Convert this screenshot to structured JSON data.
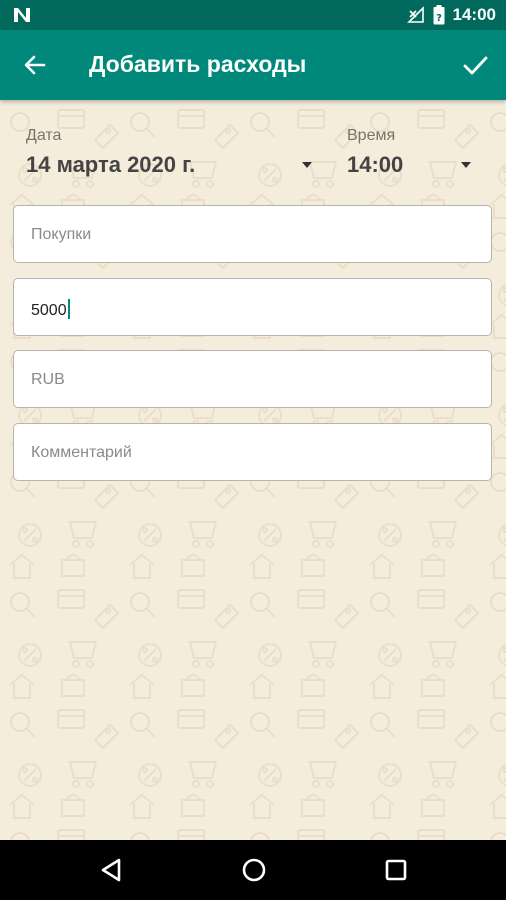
{
  "status_bar": {
    "time": "14:00",
    "icons": [
      "notification-n-icon",
      "signal-no-service-icon",
      "battery-icon"
    ]
  },
  "app_bar": {
    "title": "Добавить расходы",
    "back_icon": "arrow-left-icon",
    "confirm_icon": "check-icon"
  },
  "form": {
    "date": {
      "label": "Дата",
      "value": "14 марта 2020 г."
    },
    "time": {
      "label": "Время",
      "value": "14:00"
    },
    "fields": [
      {
        "placeholder": "Покупки",
        "value": ""
      },
      {
        "placeholder": "",
        "value": "5000"
      },
      {
        "placeholder": "RUB",
        "value": ""
      },
      {
        "placeholder": "Комментарий",
        "value": ""
      }
    ]
  },
  "nav_bar": {
    "icons": [
      "back-triangle-icon",
      "home-circle-icon",
      "recents-square-icon"
    ]
  },
  "colors": {
    "status_bar": "#00695c",
    "app_bar": "#00897b",
    "background": "#f5eddc",
    "accent": "#00897b"
  }
}
